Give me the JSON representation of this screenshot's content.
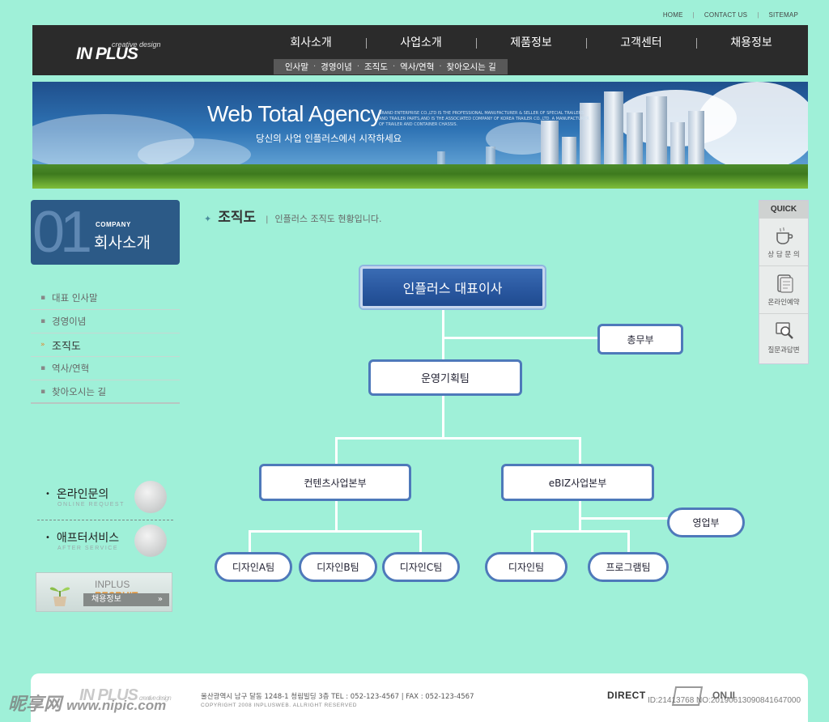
{
  "util_links": [
    "HOME",
    "CONTACT US",
    "SITEMAP"
  ],
  "header": {
    "logo_main": "IN PLUS",
    "logo_sub": "creative design",
    "main_nav": [
      "회사소개",
      "사업소개",
      "제품정보",
      "고객센터",
      "채용정보"
    ],
    "sub_nav": [
      "인사말",
      "경영이념",
      "조직도",
      "역사/연혁",
      "찾아오시는 길"
    ]
  },
  "banner": {
    "title": "Web Total Agency",
    "tagline": "당신의 사업 인플러스에서 시작하세요",
    "fine_print": "BRAND ENTERPRISE CO.,LTD IS THE PROFESSIONAL MANUFACTURER & SELLER OF SPECIAL TRAILERS AND TRAILER PARTS,AND IS THE ASSOCIATED COMPANY OF KOREA TRAILER CO.,LTD. A MANUFACTURER OF TRAILER AND CONTAINER CHASSIS."
  },
  "section": {
    "number": "01",
    "label": "COMPANY",
    "title": "회사소개"
  },
  "left_menu": [
    {
      "label": "대표 인사말",
      "active": false
    },
    {
      "label": "경영이념",
      "active": false
    },
    {
      "label": "조직도",
      "active": true
    },
    {
      "label": "역사/연혁",
      "active": false
    },
    {
      "label": "찾아오시는 길",
      "active": false
    }
  ],
  "promos": [
    {
      "title": "온라인문의",
      "sub": "ONLINE REQUEST"
    },
    {
      "title": "애프터서비스",
      "sub": "AFTER SERVICE"
    }
  ],
  "recruit": {
    "text": "INPLUS",
    "accent": "RECRUIT",
    "button": "채용정보",
    "arrow": "»"
  },
  "page": {
    "title": "조직도",
    "desc": "인플러스 조직도 현황입니다."
  },
  "org": {
    "ceo": "인플러스 대표이사",
    "general_affairs": "총무부",
    "ops_planning": "운영기획팀",
    "content_div": "컨텐츠사업본부",
    "ebiz_div": "eBIZ사업본부",
    "sales": "영업부",
    "design_a": "디자인A팀",
    "design_b": "디자인B팀",
    "design_c": "디자인C팀",
    "design": "디자인팀",
    "program": "프로그램팀"
  },
  "quick": {
    "header": "QUICK",
    "items": [
      {
        "label": "상 담 문 의",
        "icon": "coffee-cup-icon"
      },
      {
        "label": "온라인예약",
        "icon": "document-icon"
      },
      {
        "label": "질문과답변",
        "icon": "magnifier-monitor-icon"
      }
    ]
  },
  "footer": {
    "logo": "IN PLUS",
    "logo_sub": "creative design",
    "address": "울산광역시 남구 달동 1248-1 청림빌딩 3층     TEL : 052-123-4567   |   FAX : 052-123-4567",
    "copyright": "COPYRIGHT 2008 INPLUSWEB. ALLRIGHT RESERVED",
    "direct": "DIRECT",
    "on": "ON.II"
  },
  "watermarks": {
    "left": "昵享网",
    "left_url": "www.nipic.com",
    "right": "ID:21413768 NO:20190613090841647000"
  },
  "colors": {
    "page_bg": "#9ff0d8",
    "header_bg": "#2b2b2b",
    "node_border": "#4e79ba",
    "ceo_fill": "#2a58a0",
    "section_box": "#2c5a87",
    "accent_orange": "#e48b25"
  }
}
